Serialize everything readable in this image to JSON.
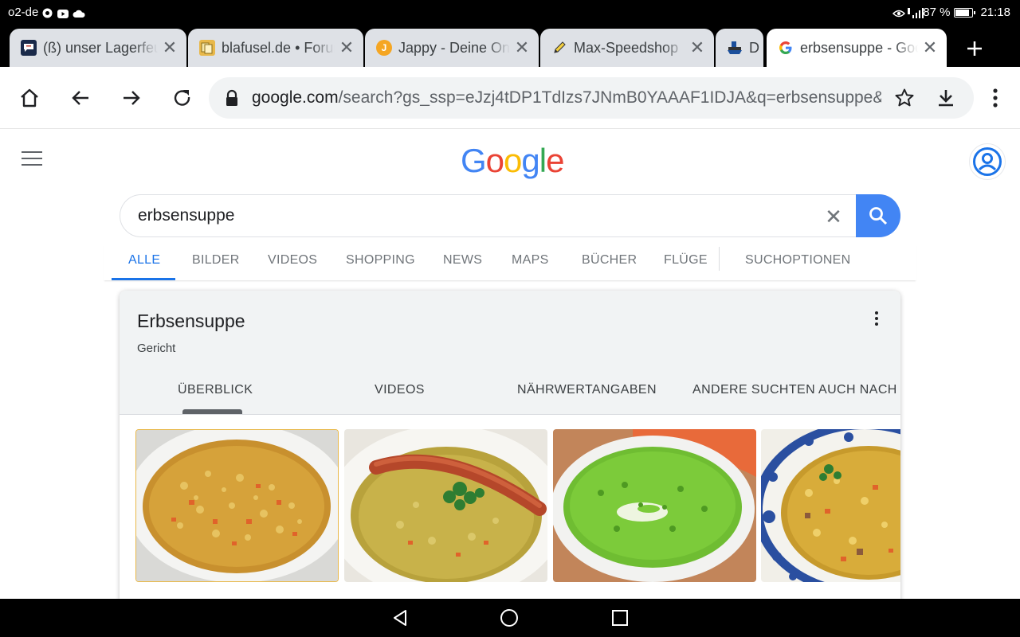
{
  "status": {
    "carrier": "o2-de",
    "battery": "87 %",
    "battery_level": 0.87,
    "time": "21:18"
  },
  "tabs": [
    {
      "title": "(ß) unser Lagerfeuer",
      "favicon": "chat-favicon",
      "color": "#1a2a4a"
    },
    {
      "title": "blafusel.de • Forum",
      "favicon": "forum-favicon",
      "color": "#e8b84a"
    },
    {
      "title": "Jappy - Deine Online",
      "favicon": "jappy-favicon",
      "color": "#f5a623"
    },
    {
      "title": "Max-Speedshop",
      "favicon": "pencil-favicon",
      "color": "#333333"
    },
    {
      "title": "D",
      "favicon": "ship-favicon",
      "color": "#1b4f9c"
    },
    {
      "title": "erbsensuppe - Google",
      "favicon": "google-favicon",
      "color": "#4285f4"
    }
  ],
  "toolbar": {
    "url_host": "google.com",
    "url_rest": "/search?gs_ssp=eJzj4tDP1TdIzs7JNmB0YAAAF1IDJA&q=erbsensuppe&"
  },
  "logo": {
    "letters": [
      "G",
      "o",
      "o",
      "g",
      "l",
      "e"
    ]
  },
  "search": {
    "query": "erbsensuppe"
  },
  "nav": {
    "items": [
      "ALLE",
      "BILDER",
      "VIDEOS",
      "SHOPPING",
      "NEWS",
      "MAPS",
      "BÜCHER",
      "FLÜGE",
      "SUCHOPTIONEN"
    ],
    "active": "ALLE"
  },
  "knowledge": {
    "title": "Erbsensuppe",
    "subtitle": "Gericht",
    "tabs": [
      "ÜBERBLICK",
      "VIDEOS",
      "NÄHRWERTANGABEN",
      "ANDERE SUCHTEN AUCH NACH"
    ],
    "images": [
      "pea-soup-image",
      "pea-soup-with-sausage-image",
      "green-pea-cream-soup-image",
      "pea-stew-blue-bowl-image"
    ]
  },
  "colors": {
    "accent": "#1a73e8",
    "search_button": "#4285f4",
    "google_blue": "#4285f4",
    "google_red": "#ea4335",
    "google_yellow": "#fbbc05",
    "google_green": "#34a853"
  }
}
